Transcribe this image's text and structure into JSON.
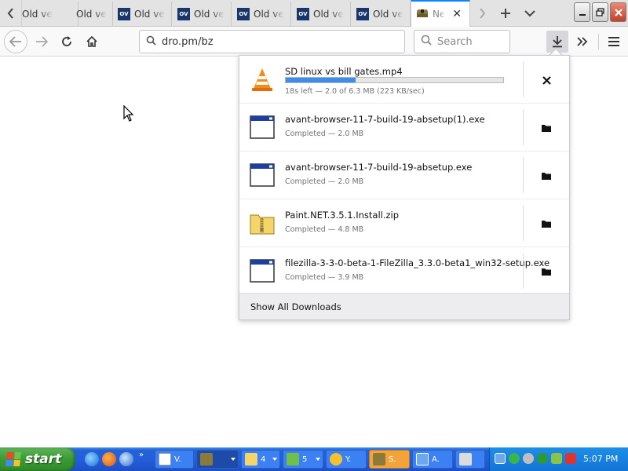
{
  "browser": {
    "tabs": [
      {
        "title": "Old ve",
        "favicon": "old-version-icon",
        "show_favicon": false
      },
      {
        "title": "Old ve",
        "favicon": "none",
        "show_favicon": false
      },
      {
        "title": "Old ve",
        "favicon": "old-version-icon",
        "show_favicon": true
      },
      {
        "title": "Old ve",
        "favicon": "old-version-icon",
        "show_favicon": true
      },
      {
        "title": "Old ve",
        "favicon": "old-version-icon",
        "show_favicon": true
      },
      {
        "title": "Old ve",
        "favicon": "old-version-icon",
        "show_favicon": true
      },
      {
        "title": "Old ve",
        "favicon": "old-version-icon",
        "show_favicon": true
      },
      {
        "title": "Ne",
        "favicon": "mascot-icon",
        "active": true
      }
    ],
    "favicon_text": "OV",
    "url": "dro.pm/bz",
    "search_placeholder": "Search"
  },
  "downloads": {
    "items": [
      {
        "name": "SD linux vs bill gates.mp4",
        "status": "18s left — 2.0 of 6.3 MB (223 KB/sec)",
        "icon": "vlc-cone-icon",
        "progress": 0.32,
        "in_progress": true,
        "action_icon": "cancel-icon"
      },
      {
        "name": "avant-browser-11-7-build-19-absetup(1).exe",
        "status": "Completed — 2.0 MB",
        "icon": "exe-window-icon",
        "action_icon": "folder-icon"
      },
      {
        "name": "avant-browser-11-7-build-19-absetup.exe",
        "status": "Completed — 2.0 MB",
        "icon": "exe-window-icon",
        "action_icon": "folder-icon"
      },
      {
        "name": "Paint.NET.3.5.1.Install.zip",
        "status": "Completed — 4.8 MB",
        "icon": "zip-folder-icon",
        "action_icon": "folder-icon"
      },
      {
        "name": "filezilla-3-3-0-beta-1-FileZilla_3.3.0-beta1_win32-setup.exe",
        "status": "Completed — 3.9 MB",
        "icon": "exe-window-icon",
        "action_icon": "folder-icon"
      }
    ],
    "show_all_label": "Show All Downloads"
  },
  "taskbar": {
    "start_label": "start",
    "buttons": [
      {
        "label": "V.",
        "icon": "notepad-icon"
      },
      {
        "label": "",
        "icon": "mascot-icon",
        "pressed": true
      },
      {
        "label": "4",
        "icon": "folder-icon"
      },
      {
        "label": "5",
        "icon": "plant-icon"
      },
      {
        "label": "Y.",
        "icon": "smiley-icon"
      },
      {
        "label": "S.",
        "icon": "mascot-icon",
        "orange": true
      },
      {
        "label": "A.",
        "icon": "avant-icon"
      },
      {
        "label": "",
        "icon": "keyboard-icon"
      }
    ],
    "clock": "5:07 PM"
  },
  "colors": {
    "accent": "#0a84ff",
    "progress": "#3c8ee8",
    "taskbar": "#245edb",
    "start": "#3a9a34"
  }
}
